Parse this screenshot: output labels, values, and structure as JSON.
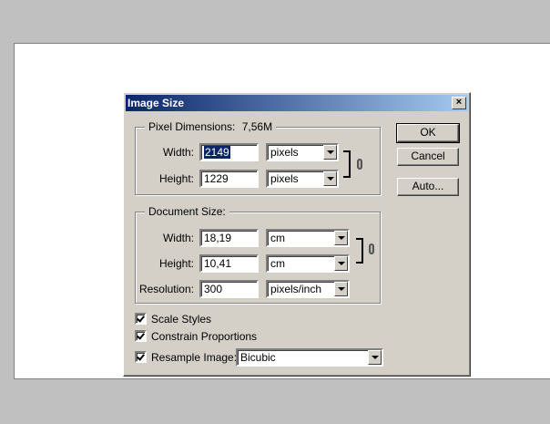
{
  "dialog": {
    "title": "Image Size",
    "close_glyph": "×"
  },
  "pixel_dimensions": {
    "legend": "Pixel Dimensions:",
    "size": "7,56M",
    "width_label": "Width:",
    "width_value": "2149",
    "width_unit": "pixels",
    "height_label": "Height:",
    "height_value": "1229",
    "height_unit": "pixels"
  },
  "document_size": {
    "legend": "Document Size:",
    "width_label": "Width:",
    "width_value": "18,19",
    "width_unit": "cm",
    "height_label": "Height:",
    "height_value": "10,41",
    "height_unit": "cm",
    "resolution_label": "Resolution:",
    "resolution_value": "300",
    "resolution_unit": "pixels/inch"
  },
  "options": {
    "scale_styles": "Scale Styles",
    "constrain_proportions": "Constrain Proportions",
    "resample_image": "Resample Image:",
    "resample_method": "Bicubic"
  },
  "buttons": {
    "ok": "OK",
    "cancel": "Cancel",
    "auto": "Auto..."
  }
}
